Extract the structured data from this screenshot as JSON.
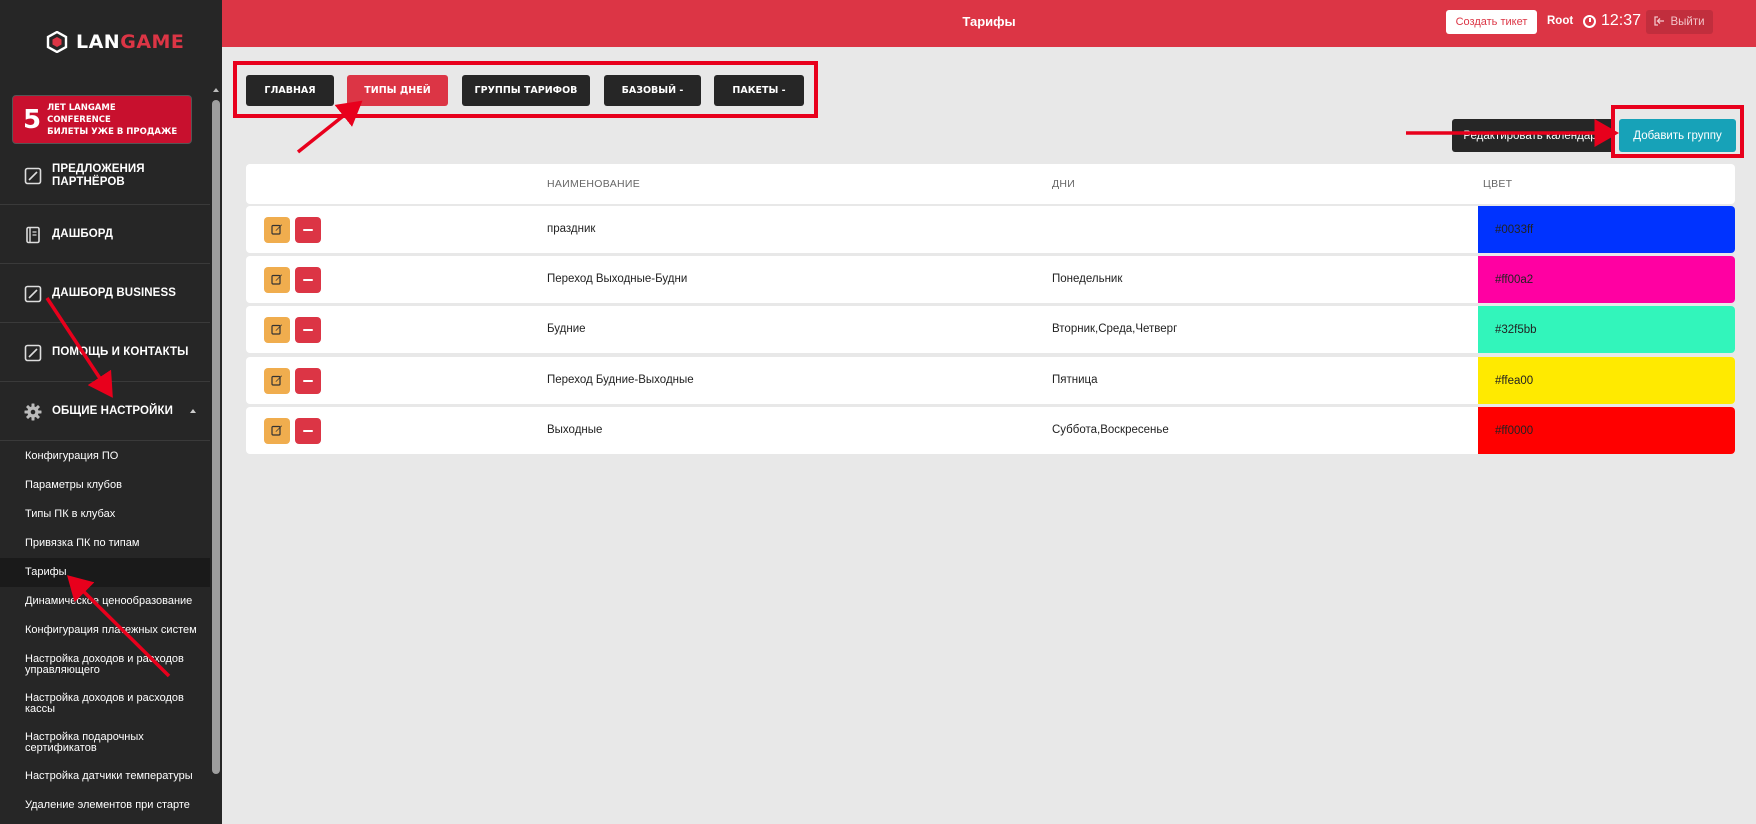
{
  "sidebar": {
    "logo": {
      "prefix": "LAN",
      "accent": "GAME"
    },
    "promo": {
      "number": "5",
      "line1": "ЛЕТ LANGAME",
      "line2": "CONFERENCE",
      "line3": "БИЛЕТЫ УЖЕ В ПРОДАЖЕ"
    },
    "nav": [
      {
        "label": "ПРЕДЛОЖЕНИЯ ПАРТНЁРОВ",
        "icon": "pencil-square-icon"
      },
      {
        "label": "ДАШБОРД",
        "icon": "notebook-icon"
      },
      {
        "label": "ДАШБОРД BUSINESS",
        "icon": "pencil-square-icon"
      },
      {
        "label": "ПОМОЩЬ И КОНТАКТЫ",
        "icon": "pencil-square-icon"
      },
      {
        "label": "ОБЩИЕ НАСТРОЙКИ",
        "icon": "gear-icon"
      }
    ],
    "sub": [
      "Конфигурация ПО",
      "Параметры клубов",
      "Типы ПК в клубах",
      "Привязка ПК по типам",
      "Тарифы",
      "Динамическое ценообразование",
      "Конфигурация платежных систем",
      "Настройка доходов и расходов управляющего",
      "Настройка доходов и расходов кассы",
      "Настройка подарочных сертификатов",
      "Настройка датчики температуры",
      "Удаление элементов при старте"
    ],
    "active_sub": "Тарифы"
  },
  "header": {
    "title": "Тарифы",
    "ticket_button": "Создать тикет",
    "user": "Root",
    "time": "12:37",
    "logout": "Выйти"
  },
  "tabs": [
    {
      "label": "ГЛАВНАЯ",
      "active": false
    },
    {
      "label": "ТИПЫ ДНЕЙ",
      "active": true
    },
    {
      "label": "ГРУППЫ ТАРИФОВ",
      "active": false
    },
    {
      "label": "БАЗОВЫЙ -",
      "active": false
    },
    {
      "label": "ПАКЕТЫ -",
      "active": false
    }
  ],
  "actions": {
    "edit_calendar": "Редактировать календарь",
    "add_group": "Добавить группу"
  },
  "table": {
    "columns": [
      "НАИМЕНОВАНИЕ",
      "ДНИ",
      "ЦВЕТ"
    ],
    "rows": [
      {
        "name": "праздник",
        "days": "",
        "color": "#0033ff"
      },
      {
        "name": "Переход Выходные-Будни",
        "days": "Понедельник",
        "color": "#ff00a2"
      },
      {
        "name": "Будние",
        "days": "Вторник,Среда,Четверг",
        "color": "#32f5bb"
      },
      {
        "name": "Переход Будние-Выходные",
        "days": "Пятница",
        "color": "#ffea00"
      },
      {
        "name": "Выходные",
        "days": "Суббота,Воскресенье",
        "color": "#ff0000"
      }
    ]
  },
  "colors": {
    "brand_red": "#dc3545",
    "sidebar_bg": "#262626",
    "accent_teal": "#17a2b8",
    "edit_orange": "#f0ad4e",
    "annotation_red": "#e8001c"
  }
}
